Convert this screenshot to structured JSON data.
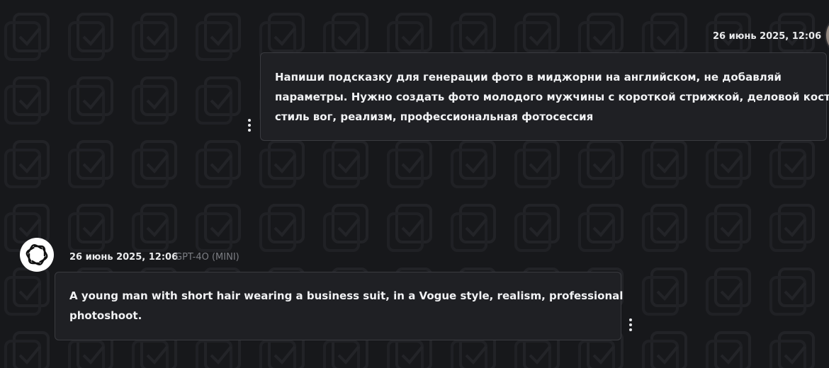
{
  "colors": {
    "background": "#17181b",
    "bubble_bg": "#1f2024",
    "bubble_border": "#3a3b40",
    "text": "#f1f2f4",
    "muted": "#7c7e84"
  },
  "user_message": {
    "timestamp": "26 июнь 2025, 12:06",
    "lines": [
      "Напиши подсказку для генерации фото в миджорни на английском, не добавляй",
      "параметры. Нужно создать фото молодого мужчины с короткой стрижкой, деловой костюм,",
      "стиль вог, реализм, профессиональная фотосессия"
    ],
    "menu_icon": "kebab-vertical-icon"
  },
  "assistant_message": {
    "timestamp": "26 июнь 2025, 12:06",
    "model": "GPT-4O (MINI)",
    "lines": [
      "A young man with short hair wearing a business suit, in a Vogue style, realism, professional",
      "photoshoot."
    ],
    "avatar_icon": "openai-logo-icon",
    "menu_icon": "kebab-vertical-icon"
  }
}
